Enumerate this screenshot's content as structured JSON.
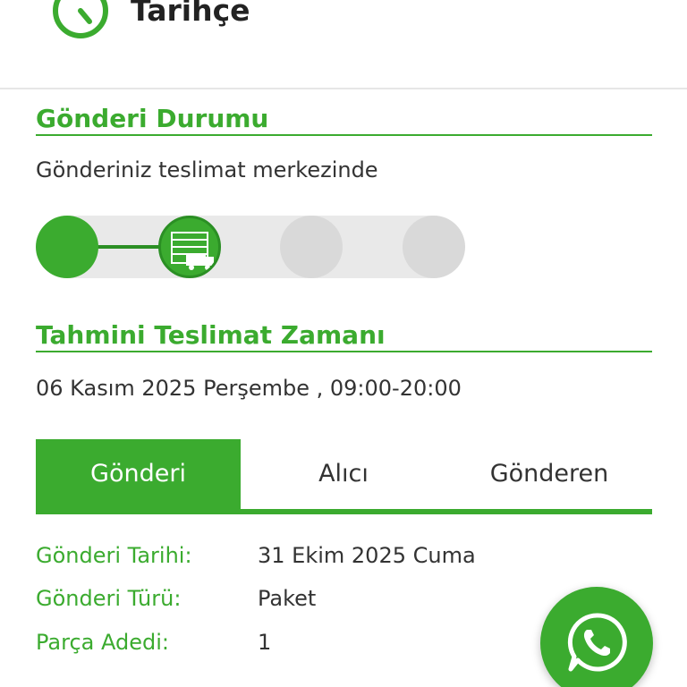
{
  "header": {
    "title": "Tarihçe",
    "icon": "history-icon"
  },
  "shipment_status": {
    "title": "Gönderi Durumu",
    "status_text": "Gönderiniz teslimat merkezinde",
    "progress": {
      "total_steps": 4,
      "current_step": 2,
      "active_step_icon": "warehouse-truck-icon"
    }
  },
  "estimated_delivery": {
    "title": "Tahmini Teslimat Zamanı",
    "value": "06 Kasım 2025 Perşembe , 09:00-20:00"
  },
  "tabs": [
    {
      "label": "Gönderi",
      "active": true
    },
    {
      "label": "Alıcı",
      "active": false
    },
    {
      "label": "Gönderen",
      "active": false
    }
  ],
  "details": [
    {
      "label": "Gönderi Tarihi:",
      "value": "31 Ekim 2025 Cuma"
    },
    {
      "label": "Gönderi Türü:",
      "value": "Paket"
    },
    {
      "label": "Parça Adedi:",
      "value": "1"
    }
  ],
  "floating_button": {
    "icon": "whatsapp-icon"
  },
  "colors": {
    "brand_green": "#3bab2f",
    "dark_green": "#2b8f24",
    "pending_grey": "#d9d9d9",
    "track_grey": "#e9e9e9"
  }
}
